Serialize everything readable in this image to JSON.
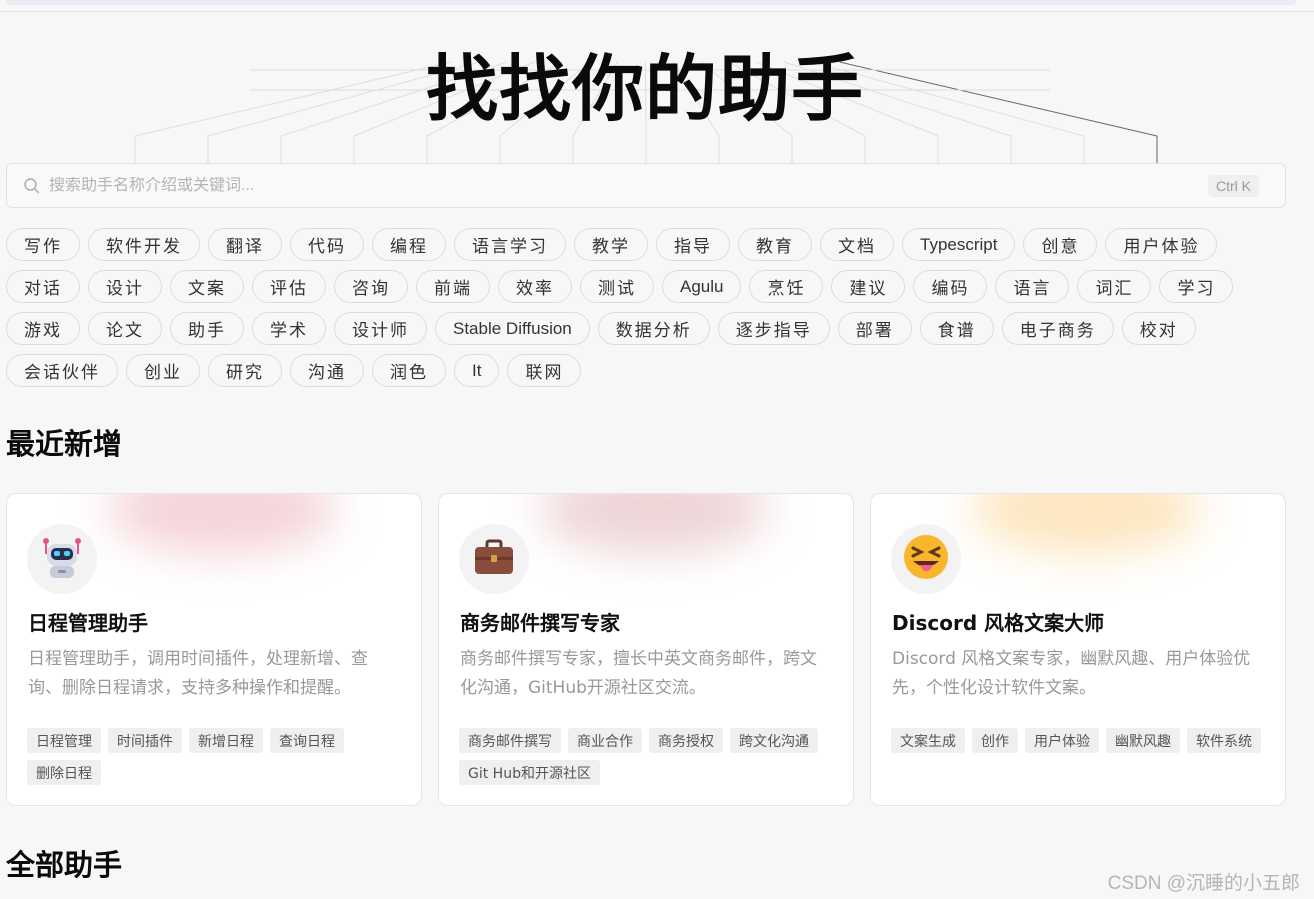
{
  "hero": {
    "title": "找找你的助手"
  },
  "search": {
    "placeholder": "搜索助手名称介绍或关键词...",
    "value": "",
    "shortcut": "Ctrl K"
  },
  "tags": [
    "写作",
    "软件开发",
    "翻译",
    "代码",
    "编程",
    "语言学习",
    "教学",
    "指导",
    "教育",
    "文档",
    "Typescript",
    "创意",
    "用户体验",
    "对话",
    "设计",
    "文案",
    "评估",
    "咨询",
    "前端",
    "效率",
    "测试",
    "Agulu",
    "烹饪",
    "建议",
    "编码",
    "语言",
    "词汇",
    "学习",
    "游戏",
    "论文",
    "助手",
    "学术",
    "设计师",
    "Stable Diffusion",
    "数据分析",
    "逐步指导",
    "部署",
    "食谱",
    "电子商务",
    "校对",
    "会话伙伴",
    "创业",
    "研究",
    "沟通",
    "润色",
    "It",
    "联网"
  ],
  "sections": {
    "recent": "最近新增",
    "all": "全部助手"
  },
  "cards": [
    {
      "icon": "robot-icon",
      "accent": "#f4cfd4",
      "title": "日程管理助手",
      "desc": "日程管理助手，调用时间插件，处理新增、查询、删除日程请求，支持多种操作和提醒。",
      "tags": [
        "日程管理",
        "时间插件",
        "新增日程",
        "查询日程",
        "删除日程"
      ]
    },
    {
      "icon": "briefcase-icon",
      "accent": "#ecd0d2",
      "title": "商务邮件撰写专家",
      "desc": "商务邮件撰写专家，擅长中英文商务邮件，跨文化沟通，GitHub开源社区交流。",
      "tags": [
        "商务邮件撰写",
        "商业合作",
        "商务授权",
        "跨文化沟通",
        "Git Hub和开源社区"
      ]
    },
    {
      "icon": "squinting-tongue-face-icon",
      "accent": "#fde3b8",
      "title": "Discord 风格文案大师",
      "desc": "Discord 风格文案专家，幽默风趣、用户体验优先，个性化设计软件文案。",
      "tags": [
        "文案生成",
        "创作",
        "用户体验",
        "幽默风趣",
        "软件系统"
      ]
    }
  ],
  "watermark": "CSDN @沉睡的小五郎"
}
